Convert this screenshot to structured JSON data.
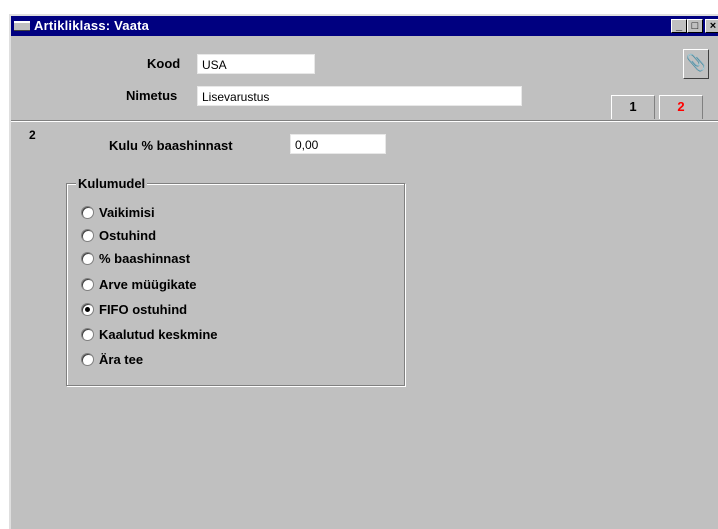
{
  "window": {
    "title": "Artikliklass: Vaata",
    "controls": {
      "minimize": "_",
      "maximize": "□",
      "close": "×"
    }
  },
  "header": {
    "kood_label": "Kood",
    "kood_value": "USA",
    "nimetus_label": "Nimetus",
    "nimetus_value": "Lisevarustus",
    "attachment_icon": "paperclip-icon"
  },
  "tabs": [
    {
      "label": "1",
      "active": false
    },
    {
      "label": "2",
      "active": true,
      "color": "#ff0000"
    }
  ],
  "page": {
    "number": "2",
    "kulu_label": "Kulu % baashinnast",
    "kulu_value": "0,00"
  },
  "kulumudel": {
    "title": "Kulumudel",
    "options": [
      {
        "label": "Vaikimisi",
        "selected": false
      },
      {
        "label": "Ostuhind",
        "selected": false
      },
      {
        "label": "% baashinnast",
        "selected": false
      },
      {
        "label": "Arve müügikate",
        "selected": false
      },
      {
        "label": "FIFO ostuhind",
        "selected": true
      },
      {
        "label": "Kaalutud keskmine",
        "selected": false
      },
      {
        "label": "Ära tee",
        "selected": false
      }
    ]
  }
}
